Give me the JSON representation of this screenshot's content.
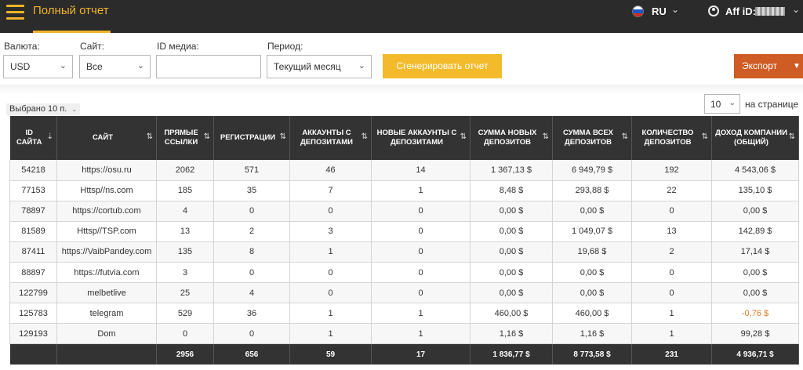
{
  "header": {
    "title": "Полный отчет",
    "language": "RU",
    "aff_label": "Aff iD:"
  },
  "filters": {
    "currency_label": "Валюта:",
    "currency_value": "USD",
    "site_label": "Сайт:",
    "site_value": "Все",
    "media_label": "ID медиа:",
    "media_value": "",
    "period_label": "Период:",
    "period_value": "Текущий месяц",
    "generate_label": "Сгенерировать отчет",
    "export_label": "Экспорт"
  },
  "table_controls": {
    "selected_label": "Выбрано 10 п.",
    "per_page_value": "10",
    "per_page_label": "на странице"
  },
  "colors": {
    "accent": "#f0b429",
    "button_yellow": "#f3bb2c",
    "export_orange": "#cf5c24",
    "header_dark": "#333333",
    "negative": "#e07a20"
  },
  "table": {
    "columns": [
      "ID сайта",
      "Сайт",
      "Прямые ссылки",
      "Регистрации",
      "Аккаунты с депозитами",
      "Новые аккаунты с депозитами",
      "Сумма новых депозитов",
      "Сумма всех депозитов",
      "Количество депозитов",
      "Доход компании (общий)"
    ],
    "rows": [
      [
        "54218",
        "https://osu.ru",
        "2062",
        "571",
        "46",
        "14",
        "1 367,13 $",
        "6 949,79 $",
        "192",
        "4 543,06 $"
      ],
      [
        "77153",
        "Httsp//ns.com",
        "185",
        "35",
        "7",
        "1",
        "8,48 $",
        "293,88 $",
        "22",
        "135,10 $"
      ],
      [
        "78897",
        "https://cortub.com",
        "4",
        "0",
        "0",
        "0",
        "0,00 $",
        "0,00 $",
        "0",
        "0,00 $"
      ],
      [
        "81589",
        "Httsp//TSP.com",
        "13",
        "2",
        "3",
        "0",
        "0,00 $",
        "1 049,07 $",
        "13",
        "142,89 $"
      ],
      [
        "87411",
        "https://VaibPandey.com",
        "135",
        "8",
        "1",
        "0",
        "0,00 $",
        "19,68 $",
        "2",
        "17,14 $"
      ],
      [
        "88897",
        "https://futvia.com",
        "3",
        "0",
        "0",
        "0",
        "0,00 $",
        "0,00 $",
        "0",
        "0,00 $"
      ],
      [
        "122799",
        "melbetlive",
        "25",
        "4",
        "0",
        "0",
        "0,00 $",
        "0,00 $",
        "0",
        "0,00 $"
      ],
      [
        "125783",
        "telegram",
        "529",
        "36",
        "1",
        "1",
        "460,00 $",
        "460,00 $",
        "1",
        "-0,76 $"
      ],
      [
        "129193",
        "Dom",
        "0",
        "0",
        "1",
        "1",
        "1,16 $",
        "1,16 $",
        "1",
        "99,28 $"
      ]
    ],
    "totals": [
      "",
      "",
      "2956",
      "656",
      "59",
      "17",
      "1 836,77 $",
      "8 773,58 $",
      "231",
      "4 936,71 $"
    ]
  }
}
